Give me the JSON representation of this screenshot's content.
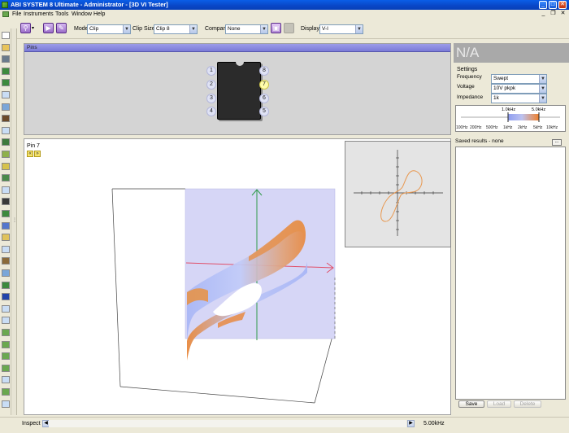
{
  "window": {
    "title": "ABI SYSTEM 8 Ultimate - Administrator - [3D VI Tester]",
    "controls": {
      "minimize": "_",
      "maximize": "□",
      "close": "✕"
    }
  },
  "menu": {
    "items": [
      "File",
      "Instruments",
      "Tools",
      "Window",
      "Help"
    ],
    "mdi_controls": {
      "minimize": "_",
      "restore": "❐",
      "close": "✕"
    }
  },
  "toolbar": {
    "mode_label": "Mode",
    "mode_value": "Clip",
    "clip_size_label": "Clip Size:",
    "clip_size_value": "Clip 8",
    "compare_label": "Compare",
    "compare_value": "None",
    "display_label": "Display:",
    "display_value": "V-I"
  },
  "ic_panel": {
    "header": "Pins",
    "pins_left": [
      "1",
      "2",
      "3",
      "4"
    ],
    "pins_right": [
      "8",
      "7",
      "6",
      "5"
    ],
    "selected_pin": "7"
  },
  "view": {
    "pin_label": "Pin 7",
    "nav_prev": "«",
    "nav_next": "»"
  },
  "right_panel": {
    "status_text": "N/A",
    "settings_title": "Settings",
    "frequency_label": "Frequency",
    "frequency_value": "Swept",
    "voltage_label": "Voltage",
    "voltage_value": "10V pkpk",
    "impedance_label": "Impedance",
    "impedance_value": "1k",
    "freq_range_markers": [
      "1.0kHz",
      "5.0kHz"
    ],
    "freq_scale": [
      "100Hz",
      "200Hz",
      "500Hz",
      "1kHz",
      "2kHz",
      "5kHz",
      "10kHz"
    ],
    "saved_title": "Saved results - none",
    "more_button": "...",
    "buttons": {
      "save": "Save",
      "load": "Load",
      "delete": "Delete"
    }
  },
  "status_bar": {
    "mode": "Inspect",
    "frequency_readout": "5.00kHz"
  },
  "colors": {
    "accent_purple": "#8a5fc0",
    "pins_bar": "#8c8ce0",
    "surface_blue": "#a8b4f4",
    "surface_orange": "#e8894a",
    "selected_pin": "#fffcaa"
  }
}
